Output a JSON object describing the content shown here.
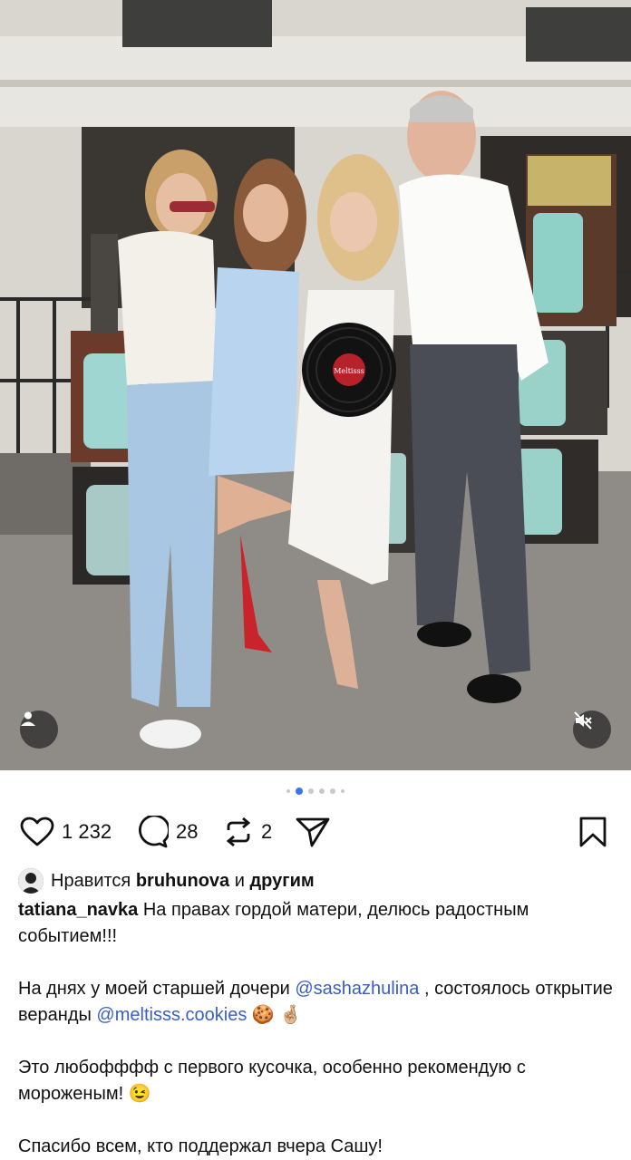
{
  "post": {
    "likes_count": "1 232",
    "comments_count": "28",
    "reposts_count": "2",
    "carousel": {
      "total": 6,
      "active": 2
    }
  },
  "icons": {
    "like": "heart-icon",
    "comment": "comment-icon",
    "repost": "repost-icon",
    "share": "send-icon",
    "save": "bookmark-icon",
    "tag": "user-tag-icon",
    "mute": "speaker-muted-icon"
  },
  "liked_by": {
    "prefix": "Нравится",
    "user": "bruhunova",
    "conj": "и",
    "others": "другим"
  },
  "caption": {
    "username": "tatiana_navka",
    "line1": "На правах гордой матери, делюсь радостным событием!!!",
    "p2_a": "На днях у моей старшей дочери",
    "mention1": "@sashazhulina",
    "p2_b": ", состоялось открытие веранды",
    "mention2": "@meltisss.cookies",
    "emoji1": "🍪",
    "emoji2": "🤞🏼",
    "p3": "Это любофффф с первого кусочка, особенно рекомендую с мороженым!",
    "emoji3": "😉",
    "p4": "Спасибо всем, кто поддержал вчера Сашу!"
  },
  "photo": {
    "record_label": "Meltisss"
  }
}
